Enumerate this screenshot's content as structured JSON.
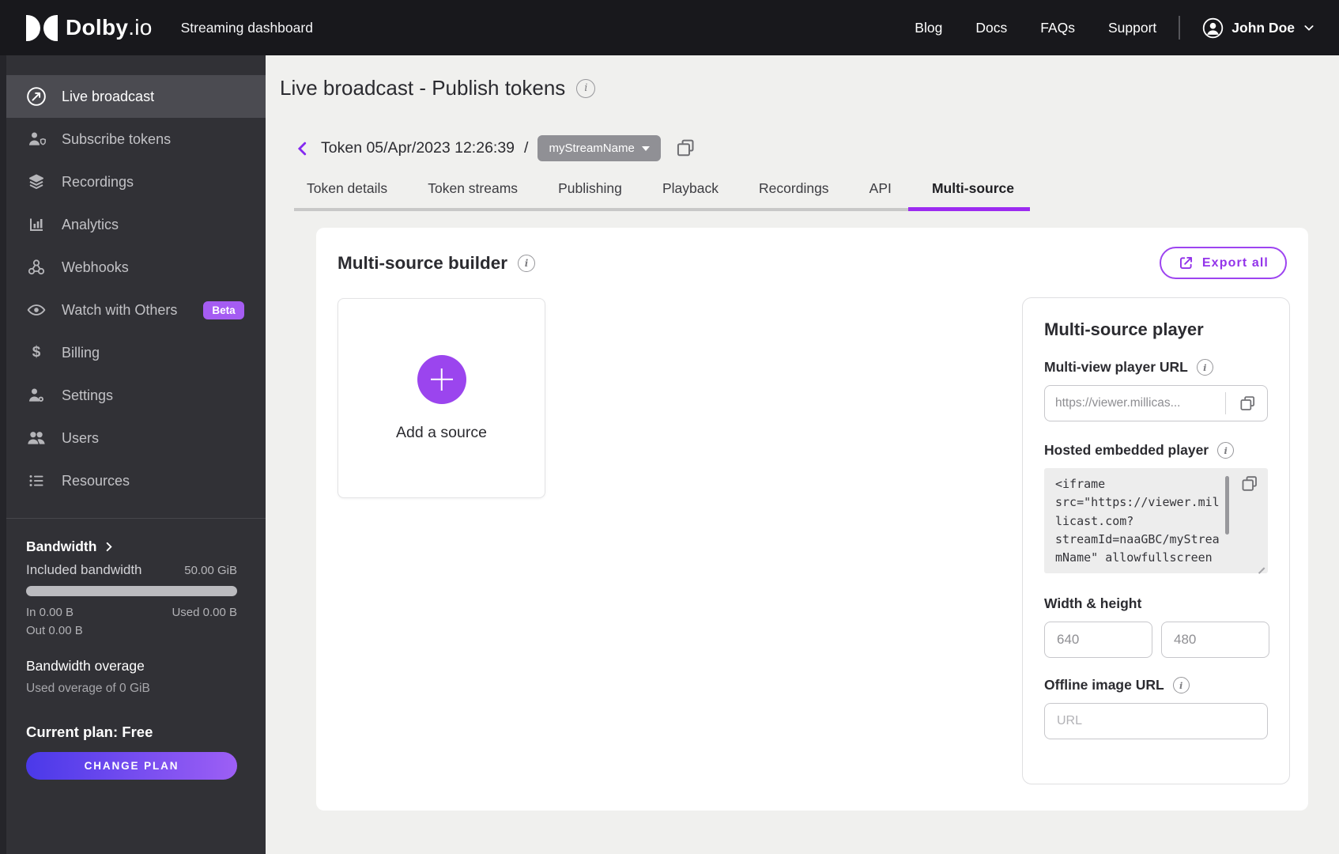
{
  "header": {
    "brand": "Dolby",
    "brand_suffix": ".io",
    "app_title": "Streaming dashboard",
    "nav": [
      {
        "label": "Blog"
      },
      {
        "label": "Docs"
      },
      {
        "label": "FAQs"
      },
      {
        "label": "Support"
      }
    ],
    "user": {
      "name": "John Doe"
    }
  },
  "sidebar": {
    "items": [
      {
        "label": "Live broadcast",
        "icon": "broadcast-icon",
        "active": true
      },
      {
        "label": "Subscribe tokens",
        "icon": "person-shield-icon"
      },
      {
        "label": "Recordings",
        "icon": "layers-icon"
      },
      {
        "label": "Analytics",
        "icon": "bar-chart-icon"
      },
      {
        "label": "Webhooks",
        "icon": "webhook-icon"
      },
      {
        "label": "Watch with Others",
        "icon": "eye-icon",
        "badge": "Beta"
      },
      {
        "label": "Billing",
        "icon": "dollar-icon",
        "icon_glyph": "$"
      },
      {
        "label": "Settings",
        "icon": "person-gear-icon"
      },
      {
        "label": "Users",
        "icon": "users-icon"
      },
      {
        "label": "Resources",
        "icon": "list-icon"
      }
    ],
    "bandwidth": {
      "title": "Bandwidth",
      "included_label": "Included bandwidth",
      "included_value": "50.00 GiB",
      "in_label": "In 0.00 B",
      "used_label": "Used 0.00 B",
      "out_label": "Out 0.00 B",
      "overage_title": "Bandwidth overage",
      "overage_detail": "Used overage of 0 GiB"
    },
    "plan": {
      "current": "Current plan: Free",
      "change_button": "CHANGE PLAN"
    }
  },
  "main": {
    "page_title": "Live broadcast - Publish tokens",
    "breadcrumb": {
      "token": "Token 05/Apr/2023 12:26:39",
      "separator": "/",
      "stream_name": "myStreamName"
    },
    "tabs": [
      {
        "label": "Token details"
      },
      {
        "label": "Token streams"
      },
      {
        "label": "Publishing"
      },
      {
        "label": "Playback"
      },
      {
        "label": "Recordings"
      },
      {
        "label": "API"
      },
      {
        "label": "Multi-source",
        "active": true
      }
    ],
    "builder": {
      "title": "Multi-source builder",
      "export_button": "Export all",
      "add_source_label": "Add a source"
    },
    "player": {
      "title": "Multi-source player",
      "url_label": "Multi-view player URL",
      "url_value": "https://viewer.millicas...",
      "embed_label": "Hosted embedded player",
      "embed_code": "<iframe\nsrc=\"https://viewer.mil\nlicast.com?\nstreamId=naaGBC/myStrea\nmName\" allowfullscreen",
      "size_label": "Width & height",
      "width_value": "640",
      "height_value": "480",
      "offline_label": "Offline image URL",
      "offline_placeholder": "URL"
    }
  },
  "colors": {
    "accent_purple": "#9b45ee",
    "tab_indicator": "#9c2bf0",
    "beta_badge": "#a55cf2",
    "plan_gradient_start": "#4a39e9",
    "plan_gradient_end": "#9d5ff5",
    "header_bg": "#18181c",
    "sidebar_bg": "#313136"
  }
}
